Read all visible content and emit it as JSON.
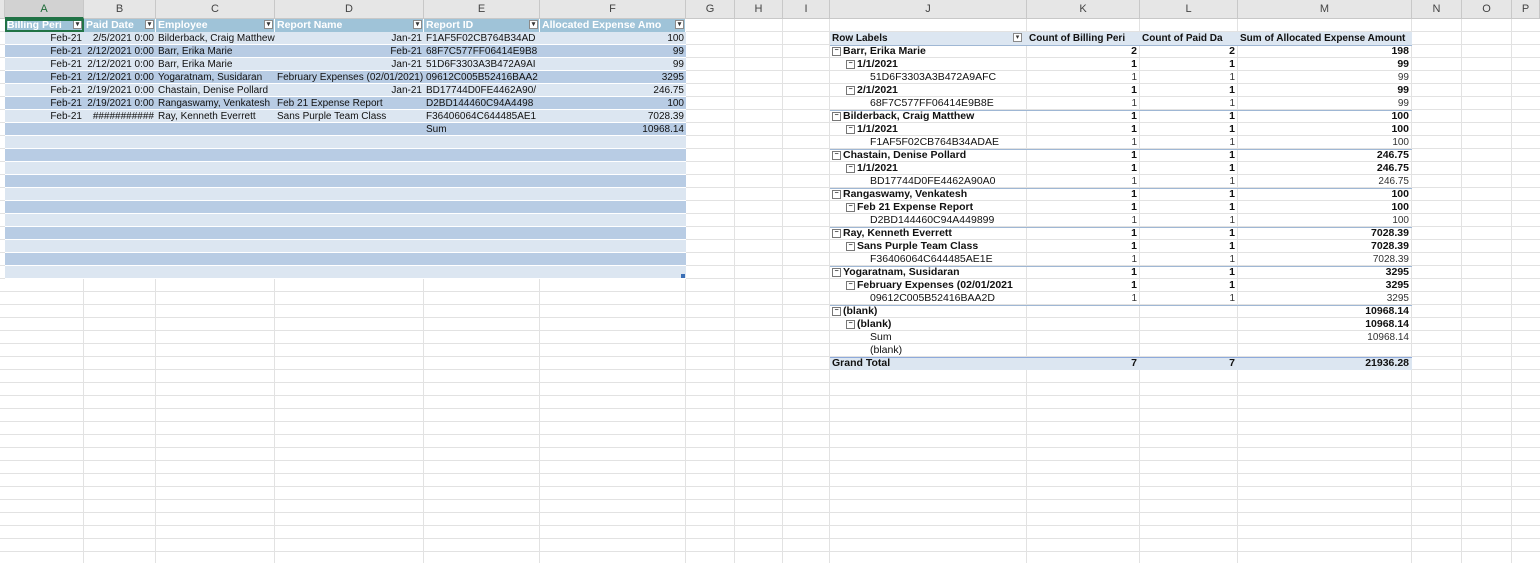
{
  "columns": [
    "A",
    "B",
    "C",
    "D",
    "E",
    "F",
    "G",
    "H",
    "I",
    "J",
    "K",
    "L",
    "M",
    "N",
    "O",
    "P"
  ],
  "table": {
    "headers": [
      "Billing Peri",
      "Paid Date",
      "Employee",
      "Report Name",
      "Report ID",
      "Allocated Expense Amo"
    ],
    "rows": [
      [
        "Feb-21",
        "2/5/2021 0:00",
        "Bilderback, Craig Matthew",
        "Jan-21",
        "F1AF5F02CB764B34AD",
        "100"
      ],
      [
        "Feb-21",
        "2/12/2021 0:00",
        "Barr, Erika Marie",
        "Feb-21",
        "68F7C577FF06414E9B8",
        "99"
      ],
      [
        "Feb-21",
        "2/12/2021 0:00",
        "Barr, Erika Marie",
        "Jan-21",
        "51D6F3303A3B472A9AI",
        "99"
      ],
      [
        "Feb-21",
        "2/12/2021 0:00",
        "Yogaratnam, Susidaran",
        "February Expenses (02/01/2021)",
        "09612C005B52416BAA2",
        "3295"
      ],
      [
        "Feb-21",
        "2/19/2021 0:00",
        "Chastain, Denise Pollard",
        "Jan-21",
        "BD17744D0FE4462A90/",
        "246.75"
      ],
      [
        "Feb-21",
        "2/19/2021 0:00",
        "Rangaswamy, Venkatesh",
        "Feb 21 Expense Report",
        "D2BD144460C94A4498",
        "100"
      ],
      [
        "Feb-21",
        "###########",
        "Ray, Kenneth Everrett",
        "Sans Purple Team Class",
        "F36406064C644485AE1",
        "7028.39"
      ],
      [
        "",
        "",
        "",
        "",
        "Sum",
        "10968.14"
      ]
    ]
  },
  "pivot": {
    "headers": [
      "Row Labels",
      "Count of Billing Peri",
      "Count of Paid Da",
      "Sum of Allocated Expense Amount"
    ],
    "rows": [
      {
        "level": 0,
        "toggle": "⊟",
        "label": "Barr, Erika Marie",
        "c1": "2",
        "c2": "2",
        "sum": "198"
      },
      {
        "level": 1,
        "toggle": "⊟",
        "label": "1/1/2021",
        "c1": "1",
        "c2": "1",
        "sum": "99"
      },
      {
        "level": 2,
        "toggle": "",
        "label": "51D6F3303A3B472A9AFC",
        "c1": "1",
        "c2": "1",
        "sum": "99"
      },
      {
        "level": 1,
        "toggle": "⊟",
        "label": "2/1/2021",
        "c1": "1",
        "c2": "1",
        "sum": "99"
      },
      {
        "level": 2,
        "toggle": "",
        "label": "68F7C577FF06414E9B8E",
        "c1": "1",
        "c2": "1",
        "sum": "99"
      },
      {
        "level": 0,
        "toggle": "⊟",
        "label": "Bilderback, Craig Matthew",
        "c1": "1",
        "c2": "1",
        "sum": "100"
      },
      {
        "level": 1,
        "toggle": "⊟",
        "label": "1/1/2021",
        "c1": "1",
        "c2": "1",
        "sum": "100"
      },
      {
        "level": 2,
        "toggle": "",
        "label": "F1AF5F02CB764B34ADAE",
        "c1": "1",
        "c2": "1",
        "sum": "100"
      },
      {
        "level": 0,
        "toggle": "⊟",
        "label": "Chastain, Denise Pollard",
        "c1": "1",
        "c2": "1",
        "sum": "246.75"
      },
      {
        "level": 1,
        "toggle": "⊟",
        "label": "1/1/2021",
        "c1": "1",
        "c2": "1",
        "sum": "246.75"
      },
      {
        "level": 2,
        "toggle": "",
        "label": "BD17744D0FE4462A90A0",
        "c1": "1",
        "c2": "1",
        "sum": "246.75"
      },
      {
        "level": 0,
        "toggle": "⊟",
        "label": "Rangaswamy, Venkatesh",
        "c1": "1",
        "c2": "1",
        "sum": "100"
      },
      {
        "level": 1,
        "toggle": "⊟",
        "label": "Feb 21 Expense Report",
        "c1": "1",
        "c2": "1",
        "sum": "100"
      },
      {
        "level": 2,
        "toggle": "",
        "label": "D2BD144460C94A449899",
        "c1": "1",
        "c2": "1",
        "sum": "100"
      },
      {
        "level": 0,
        "toggle": "⊟",
        "label": "Ray, Kenneth Everrett",
        "c1": "1",
        "c2": "1",
        "sum": "7028.39"
      },
      {
        "level": 1,
        "toggle": "⊟",
        "label": "Sans Purple Team Class",
        "c1": "1",
        "c2": "1",
        "sum": "7028.39"
      },
      {
        "level": 2,
        "toggle": "",
        "label": "F36406064C644485AE1E",
        "c1": "1",
        "c2": "1",
        "sum": "7028.39"
      },
      {
        "level": 0,
        "toggle": "⊟",
        "label": "Yogaratnam, Susidaran",
        "c1": "1",
        "c2": "1",
        "sum": "3295"
      },
      {
        "level": 1,
        "toggle": "⊟",
        "label": "February Expenses (02/01/2021",
        "c1": "1",
        "c2": "1",
        "sum": "3295"
      },
      {
        "level": 2,
        "toggle": "",
        "label": "09612C005B52416BAA2D",
        "c1": "1",
        "c2": "1",
        "sum": "3295"
      },
      {
        "level": 0,
        "toggle": "⊟",
        "label": "(blank)",
        "c1": "",
        "c2": "",
        "sum": "10968.14"
      },
      {
        "level": 1,
        "toggle": "⊟",
        "label": "(blank)",
        "c1": "",
        "c2": "",
        "sum": "10968.14"
      },
      {
        "level": 2,
        "toggle": "",
        "label": "Sum",
        "c1": "",
        "c2": "",
        "sum": "10968.14"
      },
      {
        "level": 2,
        "toggle": "",
        "label": "(blank)",
        "c1": "",
        "c2": "",
        "sum": ""
      }
    ],
    "grand_total": {
      "label": "Grand Total",
      "c1": "7",
      "c2": "7",
      "sum": "21936.28"
    }
  },
  "colors": {
    "header_blue": "#9fc3d8",
    "band_dark": "#b8cce4",
    "band_light": "#dce6f1",
    "excel_green": "#217346"
  }
}
